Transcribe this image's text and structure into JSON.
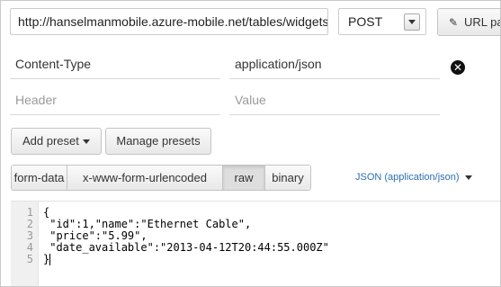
{
  "request": {
    "url": "http://hanselmanmobile.azure-mobile.net/tables/widgets",
    "method": "POST",
    "url_params_label": "URL params",
    "url_params_icon": "edit-icon"
  },
  "headers": [
    {
      "key": "Content-Type",
      "value": "application/json"
    }
  ],
  "new_header": {
    "key_placeholder": "Header",
    "value_placeholder": "Value"
  },
  "remove_icon": "close-circle-icon",
  "presets": {
    "add_label": "Add preset",
    "manage_label": "Manage presets"
  },
  "body_tabs": [
    "form-data",
    "x-www-form-urlencoded",
    "raw",
    "binary"
  ],
  "active_tab": "raw",
  "language": "JSON (application/json)",
  "editor": {
    "line_numbers": [
      "1",
      "2",
      "3",
      "4",
      "5"
    ],
    "lines": [
      "{",
      " \"id\":1,\"name\":\"Ethernet Cable\",",
      " \"price\":\"5.99\",",
      " \"date_available\":\"2013-04-12T20:44:55.000Z\"",
      "}"
    ]
  },
  "colors": {
    "link": "#2a6fb5",
    "border": "#c4c4c4",
    "gutter": "#f0f0f0"
  }
}
